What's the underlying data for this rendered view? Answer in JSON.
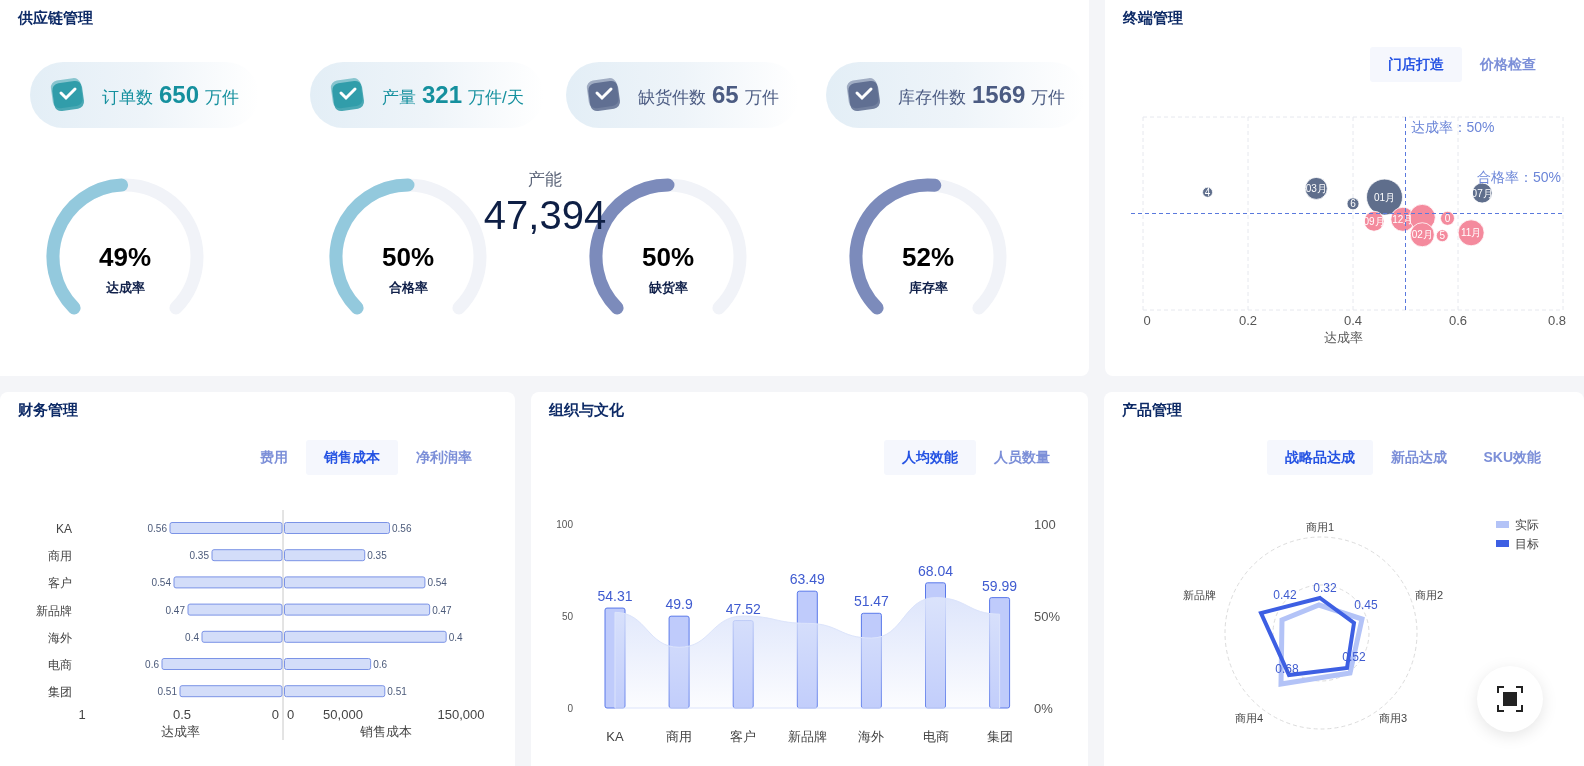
{
  "supply_chain": {
    "title": "供应链管理",
    "kpis": [
      {
        "label": "订单数",
        "value": "650",
        "unit": "万件",
        "color": "#15909e"
      },
      {
        "label": "产量",
        "value": "321",
        "unit": "万件/天",
        "color": "#15909e"
      },
      {
        "label": "缺货件数",
        "value": "65",
        "unit": "万件",
        "color": "#4b5b82"
      },
      {
        "label": "库存件数",
        "value": "1569",
        "unit": "万件",
        "color": "#4b5b82"
      }
    ],
    "capacity": {
      "label": "产能",
      "value": "47,394"
    },
    "gauges": [
      {
        "value": "49%",
        "label": "达成率",
        "level": 0.49,
        "color": "#93c9dd"
      },
      {
        "value": "50%",
        "label": "合格率",
        "level": 0.5,
        "color": "#93c9dd"
      },
      {
        "value": "50%",
        "label": "缺货率",
        "level": 0.5,
        "color": "#7c8bbb"
      },
      {
        "value": "52%",
        "label": "库存率",
        "level": 0.52,
        "color": "#7c8bbb"
      }
    ]
  },
  "terminal": {
    "title": "终端管理",
    "tabs": [
      {
        "label": "门店打造",
        "selected": true
      },
      {
        "label": "价格检查",
        "selected": false
      }
    ],
    "bubble_chart": {
      "xticks": [
        "0",
        "0.2",
        "0.4",
        "0.6",
        "0.8"
      ],
      "xlabel": "达成率",
      "bubbles": [
        {
          "label": "4",
          "color": "#5f6e8c"
        },
        {
          "label": "03月",
          "color": "#5f6e8c"
        },
        {
          "label": "6",
          "color": "#5f6e8c"
        },
        {
          "label": "01月",
          "color": "#5f6e8c"
        },
        {
          "label": "07月",
          "color": "#5f6e8c"
        },
        {
          "label": "09月",
          "color": "#f48a9d"
        },
        {
          "label": "12月",
          "color": "#f48a9d"
        },
        {
          "color": "#f48a9d"
        },
        {
          "label": "0",
          "color": "#f48a9d"
        },
        {
          "label": "02月",
          "color": "#f48a9d"
        },
        {
          "label": "5",
          "color": "#f48a9d"
        },
        {
          "label": "11月",
          "color": "#f48a9d"
        }
      ],
      "reference_lines": [
        {
          "kind": "vertical",
          "text": "达成率：50%"
        },
        {
          "kind": "horizontal",
          "text": "合格率：50%"
        }
      ]
    }
  },
  "finance": {
    "title": "财务管理",
    "tabs": [
      {
        "label": "费用",
        "selected": false
      },
      {
        "label": "销售成本",
        "selected": true
      },
      {
        "label": "净利润率",
        "selected": false
      }
    ],
    "rate_chart": {
      "chart_data": {
        "type": "bar",
        "orientation": "horizontal",
        "xlabel": "达成率",
        "xlim": [
          1,
          0
        ],
        "xticks": [
          {
            "value": 1,
            "label": "1"
          },
          {
            "value": 0.5,
            "label": "0.5"
          },
          {
            "value": 0,
            "label": "0"
          }
        ],
        "categories": [
          "KA",
          "商用",
          "客户",
          "新品牌",
          "海外",
          "电商",
          "集团"
        ],
        "data_labels": true,
        "series": [
          {
            "color": "#d3ddf9",
            "values": [
              0.56,
              0.35,
              0.54,
              0.47,
              0.4,
              0.6,
              0.51
            ]
          }
        ]
      }
    },
    "cost_chart": {
      "chart_data": {
        "type": "bar",
        "orientation": "horizontal",
        "xlabel": "销售成本",
        "xlim": [
          0,
          150000
        ],
        "xticks": [
          {
            "value": 0,
            "label": "0"
          },
          {
            "value": 50000,
            "label": "50,000"
          },
          {
            "value": 150000,
            "label": "150,000"
          }
        ],
        "series": [
          {
            "color": "#d3ddf9",
            "values": [
              89000,
              68000,
              119000,
              123000,
              137000,
              73000,
              85000
            ]
          }
        ],
        "value_labels": [
          "0.56",
          "0.35",
          "0.54",
          "0.47",
          "0.4",
          "0.6",
          "0.51"
        ]
      }
    }
  },
  "organization": {
    "title": "组织与文化",
    "tabs": [
      {
        "label": "人均效能",
        "selected": true
      },
      {
        "label": "人员数量",
        "selected": false
      }
    ],
    "chart_data": {
      "type": "bar",
      "categories": [
        "KA",
        "商用",
        "客户",
        "新品牌",
        "海外",
        "电商",
        "集团"
      ],
      "ylim": [
        0,
        100
      ],
      "yticks": [
        0,
        50,
        100
      ],
      "y2lim": [
        0,
        100
      ],
      "y2ticks": [
        {
          "value": 0,
          "label": "0%"
        },
        {
          "value": 50,
          "label": "50%"
        },
        {
          "value": 100,
          "label": "100"
        }
      ],
      "series": [
        {
          "type": "bar",
          "color": "#bfcbfb",
          "values": [
            54.31,
            49.9,
            47.52,
            63.49,
            51.47,
            68.04,
            59.99
          ],
          "value_labels": [
            "54.31",
            "49.9",
            "47.52",
            "63.49",
            "51.47",
            "68.04",
            "59.99"
          ]
        },
        {
          "type": "area",
          "color": "#dce4fb",
          "values": [
            52,
            33,
            50,
            46,
            38,
            60,
            51
          ]
        }
      ]
    }
  },
  "product": {
    "title": "产品管理",
    "tabs": [
      {
        "label": "战略品达成",
        "selected": true
      },
      {
        "label": "新品达成",
        "selected": false
      },
      {
        "label": "SKU效能",
        "selected": false
      }
    ],
    "radar": {
      "axes": [
        "商用1",
        "商用2",
        "商用3",
        "商用4",
        "新品牌"
      ],
      "value_labels": [
        "0.32",
        "0.45",
        "0.52",
        "0.68",
        "0.42"
      ],
      "legend": [
        {
          "label": "实际",
          "color": "#b3c3f7"
        },
        {
          "label": "目标",
          "color": "#3d5fe3"
        }
      ]
    }
  }
}
